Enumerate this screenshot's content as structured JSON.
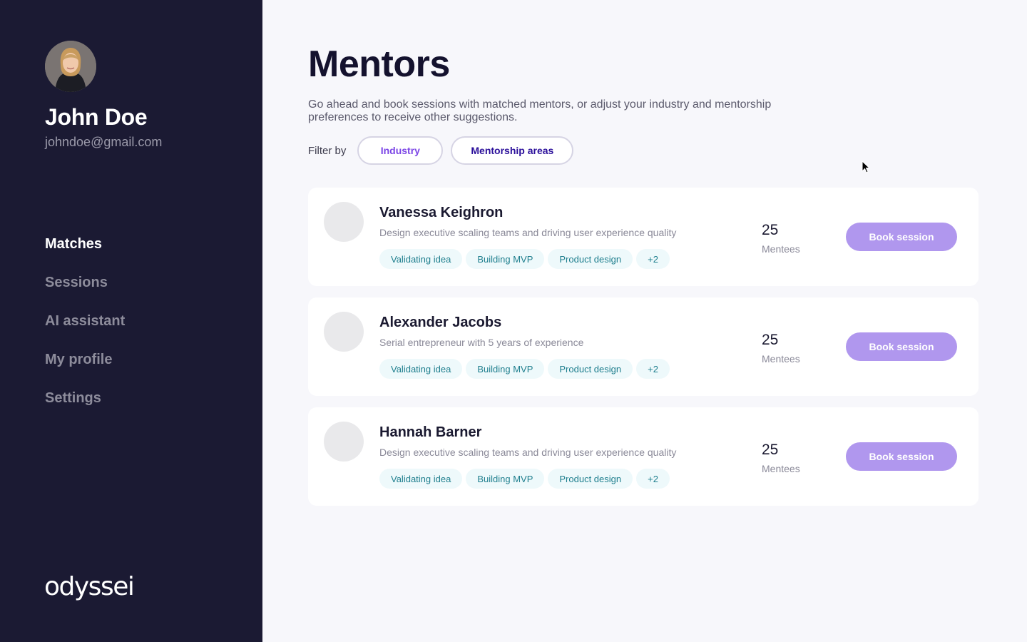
{
  "user": {
    "name": "John Doe",
    "email": "johndoe@gmail.com"
  },
  "nav": {
    "items": [
      {
        "label": "Matches",
        "active": true
      },
      {
        "label": "Sessions",
        "active": false
      },
      {
        "label": "AI assistant",
        "active": false
      },
      {
        "label": "My profile",
        "active": false
      },
      {
        "label": "Settings",
        "active": false
      }
    ]
  },
  "brand": {
    "logo_text": "odyssei"
  },
  "page": {
    "title": "Mentors",
    "description": "Go ahead and book sessions with matched mentors, or adjust your industry and mentorship preferences to receive other suggestions."
  },
  "filters": {
    "label": "Filter by",
    "options": [
      "Industry",
      "Mentorship areas"
    ]
  },
  "mentors": [
    {
      "name": "Vanessa Keighron",
      "description": "Design executive scaling teams and driving user experience quality",
      "tags": [
        "Validating idea",
        "Building MVP",
        "Product design",
        "+2"
      ],
      "mentees_count": "25",
      "mentees_label": "Mentees",
      "button_label": "Book session"
    },
    {
      "name": "Alexander Jacobs",
      "description": "Serial entrepreneur with 5 years of experience",
      "tags": [
        "Validating idea",
        "Building MVP",
        "Product design",
        "+2"
      ],
      "mentees_count": "25",
      "mentees_label": "Mentees",
      "button_label": "Book session"
    },
    {
      "name": "Hannah Barner",
      "description": "Design executive scaling teams and driving user experience quality",
      "tags": [
        "Validating idea",
        "Building MVP",
        "Product design",
        "+2"
      ],
      "mentees_count": "25",
      "mentees_label": "Mentees",
      "button_label": "Book session"
    }
  ],
  "colors": {
    "sidebar_bg": "#1b1a33",
    "accent": "#b097ee",
    "tag_text": "#1f7f8e",
    "tag_bg": "#eef9fb"
  }
}
